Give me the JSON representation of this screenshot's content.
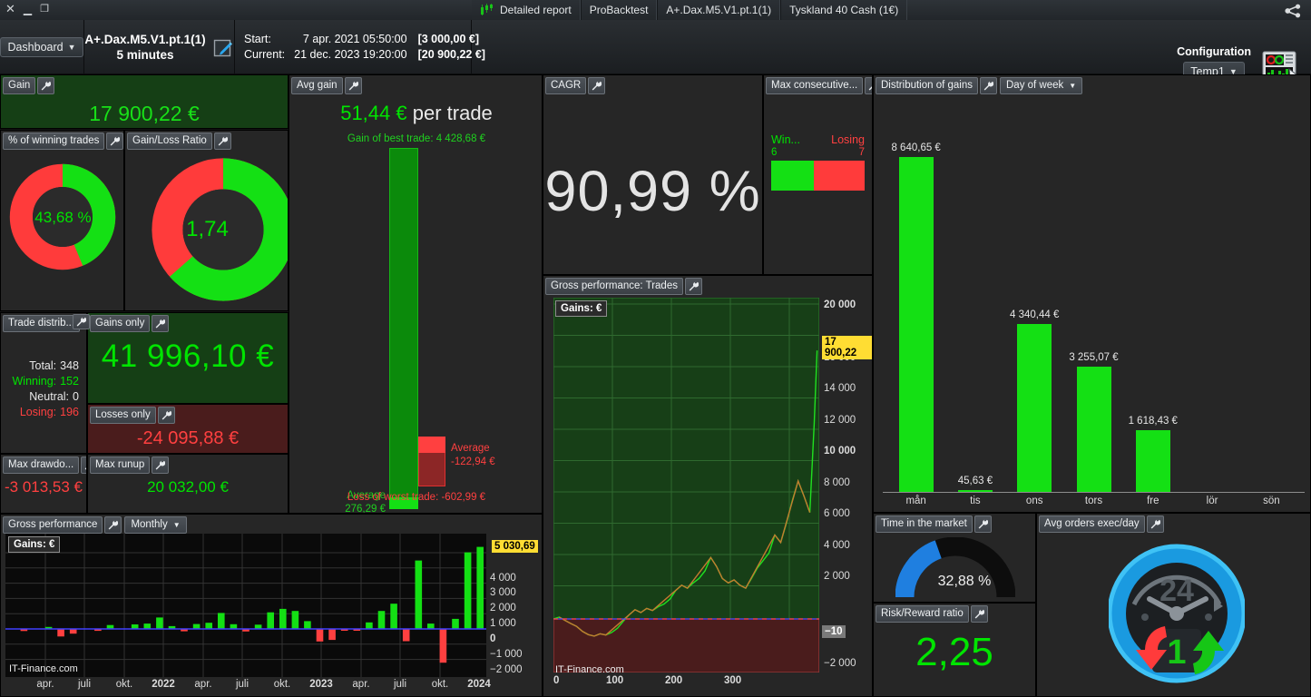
{
  "window": {
    "buttons": [
      "close-icon",
      "minimize-icon",
      "restore-icon"
    ],
    "share_icon": "share-icon"
  },
  "tabs": [
    {
      "label": "Detailed report",
      "icon": "candlestick-icon"
    },
    {
      "label": "ProBacktest"
    },
    {
      "label": "A+.Dax.M5.V1.pt.1(1)"
    },
    {
      "label": "Tyskland 40 Cash (1€)"
    }
  ],
  "header": {
    "dashboard_select": "Dashboard",
    "strategy_name": "A+.Dax.M5.V1.pt.1(1)",
    "timeframe": "5 minutes",
    "edit_icon": "edit-pencil-icon",
    "start_label": "Start:",
    "start_date": "7 apr. 2021 05:50:00",
    "start_amount": "[3 000,00 €]",
    "current_label": "Current:",
    "current_date": "21 dec. 2023 19:20:00",
    "current_amount": "[20 900,22 €]",
    "config_title": "Configuration",
    "config_value": "Temp1",
    "config_icon": "dashboard-config-icon"
  },
  "widgets": {
    "gain": {
      "title": "Gain",
      "value": "17 900,22 €"
    },
    "winning_pct": {
      "title": "% of winning trades",
      "value": "43,68 %",
      "green_fraction": 0.4368
    },
    "gain_loss_ratio": {
      "title": "Gain/Loss Ratio",
      "value": "1,74",
      "green_fraction": 0.635
    },
    "trade_distribution": {
      "title": "Trade distrib...",
      "rows": [
        {
          "label": "Total:",
          "value": "348",
          "color": "#e8e8e8"
        },
        {
          "label": "Winning:",
          "value": "152",
          "color": "#00e400"
        },
        {
          "label": "Neutral:",
          "value": "0",
          "color": "#e8e8e8"
        },
        {
          "label": "Losing:",
          "value": "196",
          "color": "#ff4040"
        }
      ]
    },
    "gains_only": {
      "title": "Gains only",
      "value": "41 996,10 €"
    },
    "losses_only": {
      "title": "Losses only",
      "value": "-24 095,88 €"
    },
    "max_drawdown": {
      "title": "Max drawdo...",
      "value": "-3 013,53 €"
    },
    "max_runup": {
      "title": "Max runup",
      "value": "20 032,00 €"
    },
    "avg_gain": {
      "title": "Avg gain",
      "headline_value": "51,44 €",
      "headline_suffix": "per trade",
      "best_trade_label": "Gain of best trade: 4 428,68 €",
      "avg_gain_label": "Average",
      "avg_gain_value": "276,29 €",
      "avg_loss_label": "Average",
      "avg_loss_value": "-122,94 €",
      "worst_trade_label": "Loss of worst trade: -602,99 €"
    },
    "cagr": {
      "title": "CAGR",
      "value": "90,99 %"
    },
    "max_consecutive": {
      "title": "Max consecutive...",
      "winning_label": "Win...",
      "losing_label": "Losing",
      "winning_value": "6",
      "losing_value": "7"
    },
    "time_in_market": {
      "title": "Time in the market",
      "value": "32,88 %",
      "fraction": 0.3288
    },
    "risk_reward": {
      "title": "Risk/Reward ratio",
      "value": "2,25"
    },
    "avg_orders": {
      "title": "Avg orders exec/day",
      "value": "1",
      "clock_label": "24"
    },
    "gross_performance_trades": {
      "title": "Gross performance: Trades",
      "dropdown": null
    },
    "gross_performance_monthly": {
      "title": "Gross performance",
      "dropdown": "Monthly"
    },
    "distribution_of_gains": {
      "title": "Distribution of gains",
      "dropdown": "Day of week"
    }
  },
  "chart_data": [
    {
      "type": "bar",
      "id": "distribution-of-gains",
      "title": "Distribution of gains",
      "grouping": "Day of week",
      "categories": [
        "mån",
        "tis",
        "ons",
        "tors",
        "fre",
        "lör",
        "sön"
      ],
      "values": [
        8640.65,
        45.63,
        4340.44,
        3255.07,
        1618.43,
        0,
        0
      ],
      "value_labels": [
        "8 640,65 €",
        "45,63 €",
        "4 340,44 €",
        "3 255,07 €",
        "1 618,43 €",
        "",
        ""
      ],
      "xlabel": "",
      "ylabel": "€",
      "ylim": [
        0,
        8640.65
      ],
      "grid": false,
      "series_color": "#14e014"
    },
    {
      "type": "area",
      "id": "gross-performance-trades",
      "title": "Gross performance: Trades",
      "legend": "Gains: €",
      "watermark": "IT-Finance.com",
      "xlabel": "",
      "ylabel": "Gains: €",
      "xticks": [
        0,
        100,
        200,
        300
      ],
      "yticks": [
        -2000,
        2000,
        4000,
        6000,
        8000,
        10000,
        12000,
        14000,
        16000,
        20000
      ],
      "ytick_labels": [
        "−2 000",
        "2 000",
        "4 000",
        "6 000",
        "8 000",
        "10 000",
        "12 000",
        "14 000",
        "16 000",
        "20 000"
      ],
      "ylim": [
        -3000,
        21000
      ],
      "xlim": [
        0,
        365
      ],
      "last_value_badge": "17 900,22",
      "zero_line_badge": "−10",
      "x": [
        0,
        8,
        16,
        24,
        32,
        40,
        48,
        56,
        64,
        72,
        80,
        88,
        96,
        104,
        112,
        120,
        128,
        136,
        144,
        152,
        160,
        168,
        176,
        184,
        192,
        200,
        208,
        216,
        224,
        232,
        240,
        248,
        256,
        264,
        272,
        280,
        288,
        296,
        304,
        312,
        320,
        328,
        336,
        344,
        352,
        358,
        362
      ],
      "y": [
        0,
        120,
        -80,
        -260,
        -420,
        -700,
        -880,
        -960,
        -830,
        -900,
        -760,
        -520,
        -120,
        280,
        620,
        430,
        700,
        560,
        820,
        1000,
        1320,
        1900,
        2250,
        2050,
        2400,
        2700,
        3200,
        4100,
        3500,
        2700,
        2400,
        2600,
        2250,
        2050,
        2700,
        3400,
        3900,
        4400,
        5600,
        5100,
        6400,
        7900,
        9200,
        8200,
        7100,
        13000,
        17900
      ]
    },
    {
      "type": "bar",
      "id": "gross-performance-monthly",
      "title": "Gross performance",
      "grouping": "Monthly",
      "legend": "Gains: €",
      "watermark": "IT-Finance.com",
      "xtick_labels": [
        "apr.",
        "juli",
        "okt.",
        "2022",
        "apr.",
        "juli",
        "okt.",
        "2023",
        "apr.",
        "juli",
        "okt.",
        "2024"
      ],
      "yticks": [
        -2000,
        -1000,
        0,
        1000,
        2000,
        3000,
        4000
      ],
      "ytick_labels": [
        "−2 000",
        "−1 000",
        "0",
        "1 000",
        "2 000",
        "3 000",
        "4 000"
      ],
      "ylim": [
        -2600,
        5400
      ],
      "last_value_badge": "5 030,69",
      "values": [
        0,
        -130,
        0,
        120,
        -480,
        -300,
        0,
        -120,
        240,
        0,
        280,
        330,
        700,
        170,
        -150,
        300,
        380,
        980,
        290,
        -160,
        260,
        1020,
        1230,
        1100,
        480,
        -800,
        -700,
        -60,
        -100,
        400,
        1100,
        1550,
        -780,
        4200,
        330,
        -2150,
        620,
        4700,
        5030
      ],
      "positive_color": "#14e014",
      "negative_color": "#ff4040"
    }
  ],
  "colors": {
    "green": "#00e400",
    "red": "#ff4040",
    "accent_blue": "#1f7fe0",
    "highlight_yellow": "#ffdd33",
    "panel_bg": "#262626",
    "gain_panel_bg": "#153f15",
    "loss_panel_bg": "#4a1c1c"
  }
}
